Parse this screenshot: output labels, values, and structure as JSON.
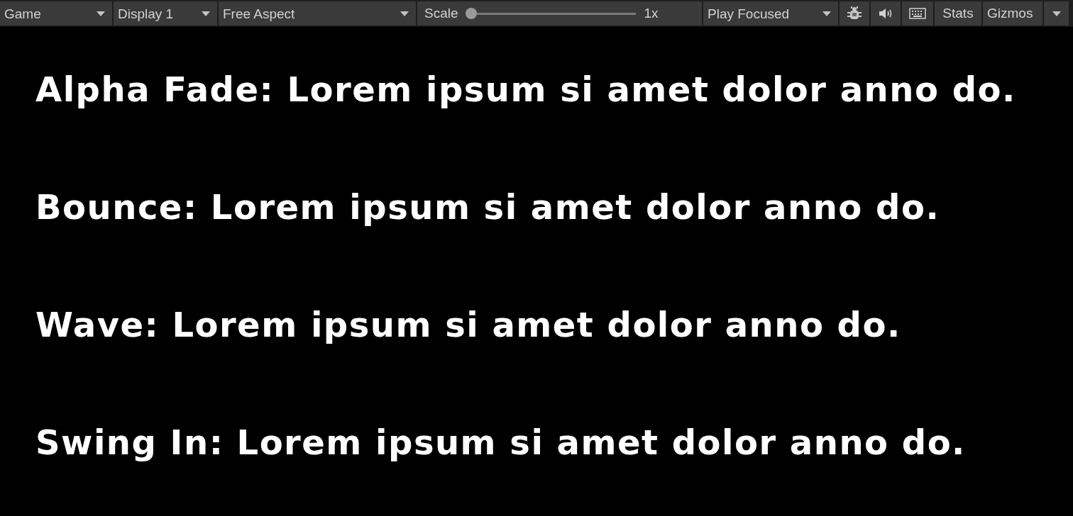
{
  "toolbar": {
    "view_dropdown": {
      "value": "Game"
    },
    "display_dropdown": {
      "value": "Display 1"
    },
    "aspect_dropdown": {
      "value": "Free Aspect"
    },
    "scale": {
      "label": "Scale",
      "level": 0,
      "reading": "1x"
    },
    "play_mode_dropdown": {
      "value": "Play Focused"
    },
    "stats_button": {
      "label": "Stats"
    },
    "gizmos_button": {
      "label": "Gizmos"
    }
  },
  "lines": [
    "Alpha Fade: Lorem ipsum si amet dolor anno do.",
    "Bounce: Lorem ipsum si amet dolor anno do.",
    "Wave: Lorem ipsum si amet dolor anno do.",
    "Swing In: Lorem ipsum si amet dolor anno do."
  ]
}
